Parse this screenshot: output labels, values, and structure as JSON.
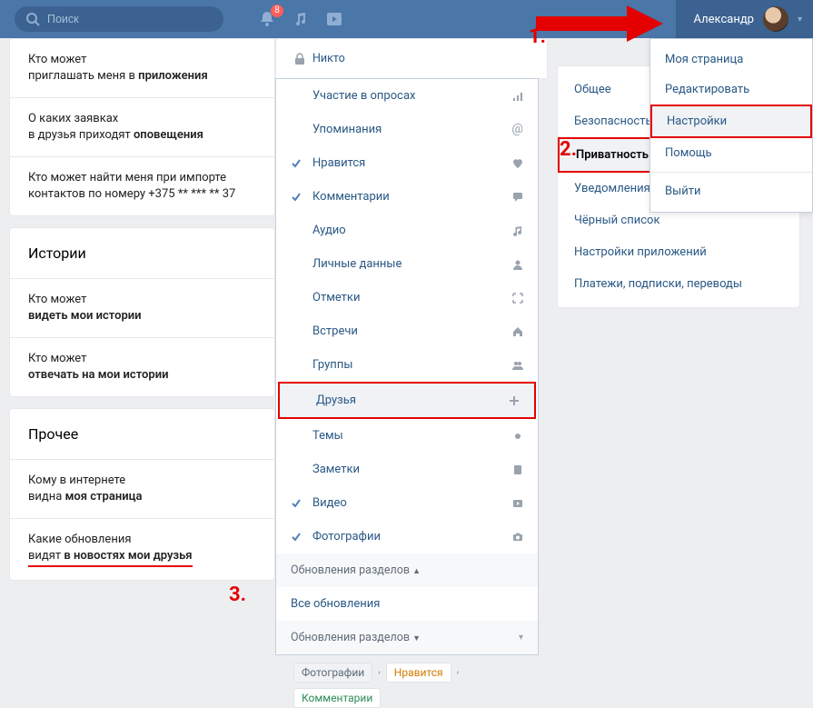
{
  "header": {
    "search_placeholder": "Поиск",
    "notification_badge": "8",
    "user_name": "Александр"
  },
  "annotations": {
    "one": "1.",
    "two": "2.",
    "three": "3."
  },
  "left": {
    "block1": {
      "setting1_line1": "Кто может",
      "setting1_line2_pre": "приглашать меня в ",
      "setting1_line2_b": "приложения",
      "setting2_line1": "О каких заявках",
      "setting2_line2_pre": "в друзья приходят ",
      "setting2_line2_b": "оповещения",
      "setting3_line1": "Кто может найти меня при импорте",
      "setting3_line2": "контактов по номеру +375 ** *** ** 37"
    },
    "block2": {
      "title": "Истории",
      "setting1_line1": "Кто может",
      "setting1_line2_b": "видеть мои истории",
      "setting2_line1": "Кто может",
      "setting2_line2_b": "отвечать на мои истории"
    },
    "block3": {
      "title": "Прочее",
      "setting1_line1": "Кому в интернете",
      "setting1_line2_pre": "видна ",
      "setting1_line2_b": "моя страница",
      "setting2_line1": "Какие обновления",
      "setting2_line2_pre": "видят ",
      "setting2_line2_b": "в новостях мои друзья"
    }
  },
  "nobody_label": "Никто",
  "dropdown": {
    "items": [
      {
        "label": "Участие в опросах",
        "icon": "bars",
        "checked": false
      },
      {
        "label": "Упоминания",
        "icon": "at",
        "checked": false
      },
      {
        "label": "Нравится",
        "icon": "heart",
        "checked": true
      },
      {
        "label": "Комментарии",
        "icon": "comment",
        "checked": true
      },
      {
        "label": "Аудио",
        "icon": "music",
        "checked": false
      },
      {
        "label": "Личные данные",
        "icon": "person",
        "checked": false
      },
      {
        "label": "Отметки",
        "icon": "expand",
        "checked": false
      },
      {
        "label": "Встречи",
        "icon": "house",
        "checked": false
      },
      {
        "label": "Группы",
        "icon": "group",
        "checked": false
      },
      {
        "label": "Друзья",
        "icon": "plus",
        "checked": false,
        "boxed": true,
        "selected": true
      },
      {
        "label": "Темы",
        "icon": "dot",
        "checked": false
      },
      {
        "label": "Заметки",
        "icon": "note",
        "checked": false
      },
      {
        "label": "Видео",
        "icon": "video",
        "checked": true
      },
      {
        "label": "Фотографии",
        "icon": "camera",
        "checked": true
      }
    ],
    "sub1": "Обновления разделов",
    "all": "Все обновления",
    "sub2": "Обновления разделов"
  },
  "tags": {
    "photo": "Фотографии",
    "like": "Нравится",
    "comment": "Комментарии"
  },
  "sidebar": {
    "items": [
      "Общее",
      "Безопасность",
      "Приватность",
      "Уведомления",
      "Чёрный список",
      "Настройки приложений",
      "Платежи, подписки, переводы"
    ]
  },
  "user_menu": {
    "items": [
      "Моя страница",
      "Редактировать",
      "Настройки",
      "Помощь",
      "Выйти"
    ]
  }
}
